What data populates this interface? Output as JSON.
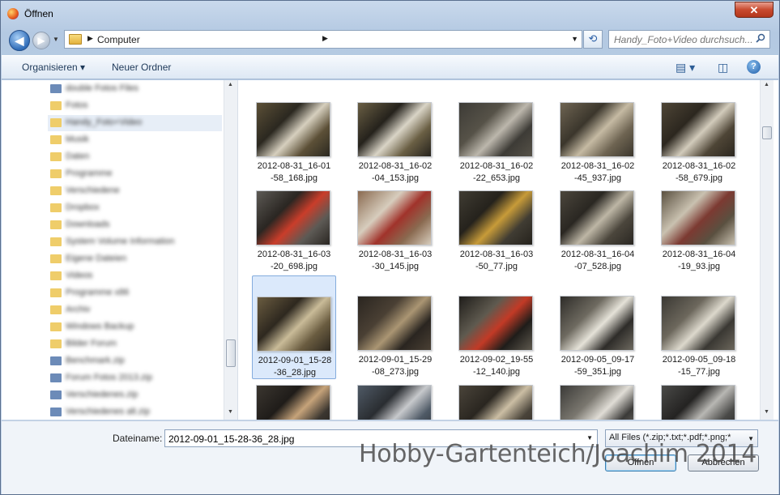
{
  "window": {
    "title": "Öffnen",
    "close_label": "✕"
  },
  "navigation": {
    "back_icon": "back-arrow-icon",
    "forward_icon": "forward-arrow-icon",
    "address": "Computer",
    "search_placeholder": "Handy_Foto+Video durchsuch..."
  },
  "toolbar": {
    "organize_label": "Organisieren ▾",
    "new_folder_label": "Neuer Ordner",
    "view_icon": "view-options-icon",
    "preview_icon": "preview-pane-icon",
    "help_label": "?"
  },
  "sidebar": {
    "items": [
      {
        "label": "double Fotos Files",
        "kind": "file"
      },
      {
        "label": "Fotos",
        "kind": "folder"
      },
      {
        "label": "Handy_Foto+Video",
        "kind": "folder",
        "selected": true
      },
      {
        "label": "Musik",
        "kind": "folder"
      },
      {
        "label": "Daten",
        "kind": "folder"
      },
      {
        "label": "Programme",
        "kind": "folder"
      },
      {
        "label": "Verschiedene",
        "kind": "folder"
      },
      {
        "label": "Dropbox",
        "kind": "folder"
      },
      {
        "label": "Downloads",
        "kind": "folder"
      },
      {
        "label": "System Volume Information",
        "kind": "folder"
      },
      {
        "label": "Eigene Dateien",
        "kind": "folder"
      },
      {
        "label": "Videos",
        "kind": "folder"
      },
      {
        "label": "Programme x86",
        "kind": "folder"
      },
      {
        "label": "Archiv",
        "kind": "folder"
      },
      {
        "label": "Windows Backup",
        "kind": "folder"
      },
      {
        "label": "Bilder Forum",
        "kind": "folder"
      },
      {
        "label": "Benchmark.zip",
        "kind": "file"
      },
      {
        "label": "Forum Fotos 2013.zip",
        "kind": "file"
      },
      {
        "label": "Verschiedenes.zip",
        "kind": "file"
      },
      {
        "label": "Verschiedenes alt.zip",
        "kind": "file"
      }
    ]
  },
  "files": [
    {
      "name": "2012-08-31_16-01-58_168.jpg",
      "colors": [
        "#5c5037",
        "#d6cfbe",
        "#2b2820"
      ]
    },
    {
      "name": "2012-08-31_16-02-04_153.jpg",
      "colors": [
        "#6a5f44",
        "#d9d4c6",
        "#25221c"
      ]
    },
    {
      "name": "2012-08-31_16-02-22_653.jpg",
      "colors": [
        "#3d3b36",
        "#bcb7ac",
        "#565248"
      ]
    },
    {
      "name": "2012-08-31_16-02-45_937.jpg",
      "colors": [
        "#6e6452",
        "#c5baa3",
        "#3b362c"
      ]
    },
    {
      "name": "2012-08-31_16-02-58_679.jpg",
      "colors": [
        "#4e4536",
        "#d2cbbb",
        "#2c271f"
      ]
    },
    {
      "name": "2012-08-31_16-03-20_698.jpg",
      "colors": [
        "#5d5a55",
        "#c93d2a",
        "#2a2622"
      ]
    },
    {
      "name": "2012-08-31_16-03-30_145.jpg",
      "colors": [
        "#8a6a50",
        "#a1332b",
        "#d7cdbd"
      ]
    },
    {
      "name": "2012-08-31_16-03-50_77.jpg",
      "colors": [
        "#403c33",
        "#c79b39",
        "#25221c"
      ]
    },
    {
      "name": "2012-08-31_16-04-07_528.jpg",
      "colors": [
        "#4b463c",
        "#bdb6a5",
        "#2a2722"
      ]
    },
    {
      "name": "2012-08-31_16-04-19_93.jpg",
      "colors": [
        "#5a5040",
        "#7c3a32",
        "#c9c1b0"
      ]
    },
    {
      "name": "2012-09-01_15-28-36_28.jpg",
      "colors": [
        "#6a5c40",
        "#c9bb98",
        "#2e281f"
      ],
      "selected": true
    },
    {
      "name": "2012-09-01_15-29-08_273.jpg",
      "colors": [
        "#2a2520",
        "#aa9573",
        "#4a4034"
      ]
    },
    {
      "name": "2012-09-02_19-55-12_140.jpg",
      "colors": [
        "#1f1d1a",
        "#c23a26",
        "#5f5a4f"
      ]
    },
    {
      "name": "2012-09-05_09-17-59_351.jpg",
      "colors": [
        "#2e2c29",
        "#e5e2d8",
        "#6e6a60"
      ]
    },
    {
      "name": "2012-09-05_09-18-15_77.jpg",
      "colors": [
        "#3a3833",
        "#dcd8cc",
        "#6c675c"
      ]
    },
    {
      "name": "",
      "colors": [
        "#3b3630",
        "#c6a37a",
        "#1f1c19"
      ]
    },
    {
      "name": "",
      "colors": [
        "#4f5a66",
        "#c7c9cc",
        "#2a2d31"
      ]
    },
    {
      "name": "",
      "colors": [
        "#4a443a",
        "#cbbea4",
        "#2a2620"
      ]
    },
    {
      "name": "",
      "colors": [
        "#3b3a38",
        "#e0ddd6",
        "#7a776f"
      ]
    },
    {
      "name": "",
      "colors": [
        "#4a4a48",
        "#b8b7b3",
        "#242322"
      ]
    }
  ],
  "footer": {
    "filename_label": "Dateiname:",
    "filename_value": "2012-09-01_15-28-36_28.jpg",
    "filter_label": "All Files (*.zip;*.txt;*.pdf;*.png;*",
    "open_label": "Öffnen",
    "cancel_label": "Abbrechen"
  },
  "watermark": "Hobby-Gartenteich/Joachim 2014"
}
